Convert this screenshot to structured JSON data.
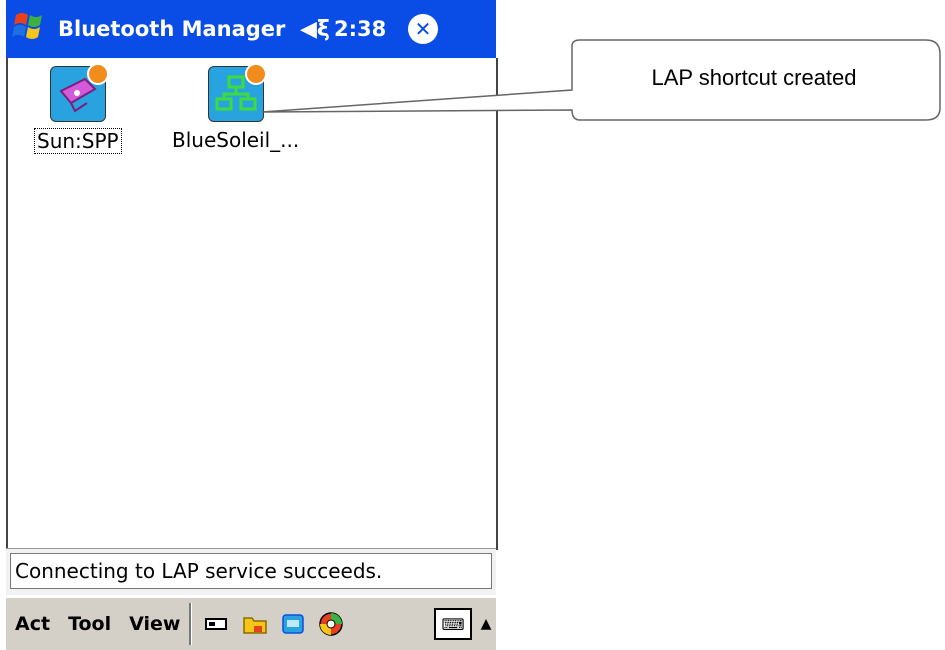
{
  "window": {
    "title": "Bluetooth Manager",
    "time": "2:38",
    "start_icon": "windows-flag-icon",
    "volume_icon": "speaker-icon",
    "close_icon": "close-icon"
  },
  "shortcuts": [
    {
      "label": "Sun:SPP",
      "icon": "serial-port-icon",
      "selected": true
    },
    {
      "label": "BlueSoleil_...",
      "icon": "lan-access-icon",
      "selected": false
    }
  ],
  "status": {
    "message": "Connecting to LAP service succeeds."
  },
  "menubar": {
    "items": [
      "Act",
      "Tool",
      "View"
    ],
    "toolbar_icons": [
      "bluetooth-device-icon",
      "folder-icon",
      "screen-icon",
      "connection-icon"
    ],
    "keyboard_icon": "keyboard-icon",
    "sip_arrow_icon": "up-arrow-icon"
  },
  "callout": {
    "text": "LAP shortcut created"
  },
  "colors": {
    "titlebar": "#0a4ce6",
    "icon_bg": "#29a3e0",
    "badge": "#f28c1c"
  }
}
